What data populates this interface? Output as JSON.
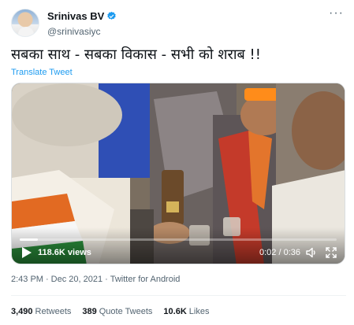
{
  "author": {
    "name": "Srinivas BV",
    "handle": "@srinivasiyc",
    "verified": true
  },
  "tweet": {
    "text": "सबका साथ - सबका विकास - सभी को शराब !!",
    "translate_label": "Translate Tweet"
  },
  "video": {
    "views": "118.6K views",
    "time": "0:02 / 0:36",
    "progress": 0.056
  },
  "meta": {
    "time": "2:43 PM",
    "date": "Dec 20, 2021",
    "source": "Twitter for Android",
    "separator": "·"
  },
  "stats": {
    "retweets_count": "3,490",
    "retweets_label": "Retweets",
    "quotes_count": "389",
    "quotes_label": "Quote Tweets",
    "likes_count": "10.6K",
    "likes_label": "Likes"
  },
  "colors": {
    "accent": "#1d9bf0",
    "secondary_text": "#536471"
  }
}
